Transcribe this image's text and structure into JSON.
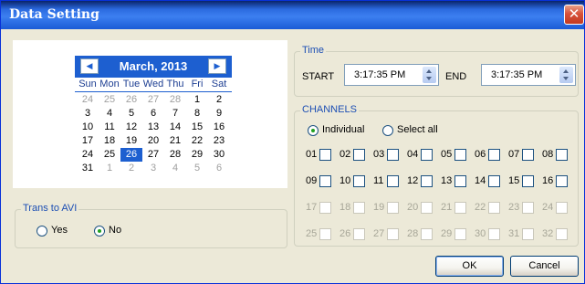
{
  "window": {
    "title": "Data Setting",
    "close_glyph": "✕"
  },
  "calendar": {
    "prev_glyph": "◀",
    "next_glyph": "▶",
    "month_label": "March, 2013",
    "weekdays": [
      "Sun",
      "Mon",
      "Tue",
      "Wed",
      "Thu",
      "Fri",
      "Sat"
    ],
    "weeks": [
      [
        "24",
        "25",
        "26",
        "27",
        "28",
        "1",
        "2"
      ],
      [
        "3",
        "4",
        "5",
        "6",
        "7",
        "8",
        "9"
      ],
      [
        "10",
        "11",
        "12",
        "13",
        "14",
        "15",
        "16"
      ],
      [
        "17",
        "18",
        "19",
        "20",
        "21",
        "22",
        "23"
      ],
      [
        "24",
        "25",
        "26",
        "27",
        "28",
        "29",
        "30"
      ],
      [
        "31",
        "1",
        "2",
        "3",
        "4",
        "5",
        "6"
      ]
    ],
    "selected_day": "26"
  },
  "trans_avi": {
    "label": "Trans to AVI",
    "options": [
      {
        "label": "Yes",
        "selected": false
      },
      {
        "label": "No",
        "selected": true
      }
    ]
  },
  "time": {
    "label": "Time",
    "start_label": "START",
    "start_value": "3:17:35 PM",
    "end_label": "END",
    "end_value": "3:17:35 PM"
  },
  "channels": {
    "label": "CHANNELS",
    "mode_options": [
      {
        "label": "Individual",
        "selected": true
      },
      {
        "label": "Select all",
        "selected": false
      }
    ],
    "rows": [
      [
        "01",
        "02",
        "03",
        "04",
        "05",
        "06",
        "07",
        "08"
      ],
      [
        "09",
        "10",
        "11",
        "12",
        "13",
        "14",
        "15",
        "16"
      ],
      [
        "17",
        "18",
        "19",
        "20",
        "21",
        "22",
        "23",
        "24"
      ],
      [
        "25",
        "26",
        "27",
        "28",
        "29",
        "30",
        "31",
        "32"
      ]
    ],
    "enabled_rows": 2
  },
  "buttons": {
    "ok": "OK",
    "cancel": "Cancel"
  },
  "colors": {
    "titlebar": "#1B5BD6",
    "calendar_header": "#1D5FD0",
    "group_label": "#1D4FB4",
    "radio_dot": "#21A121"
  }
}
